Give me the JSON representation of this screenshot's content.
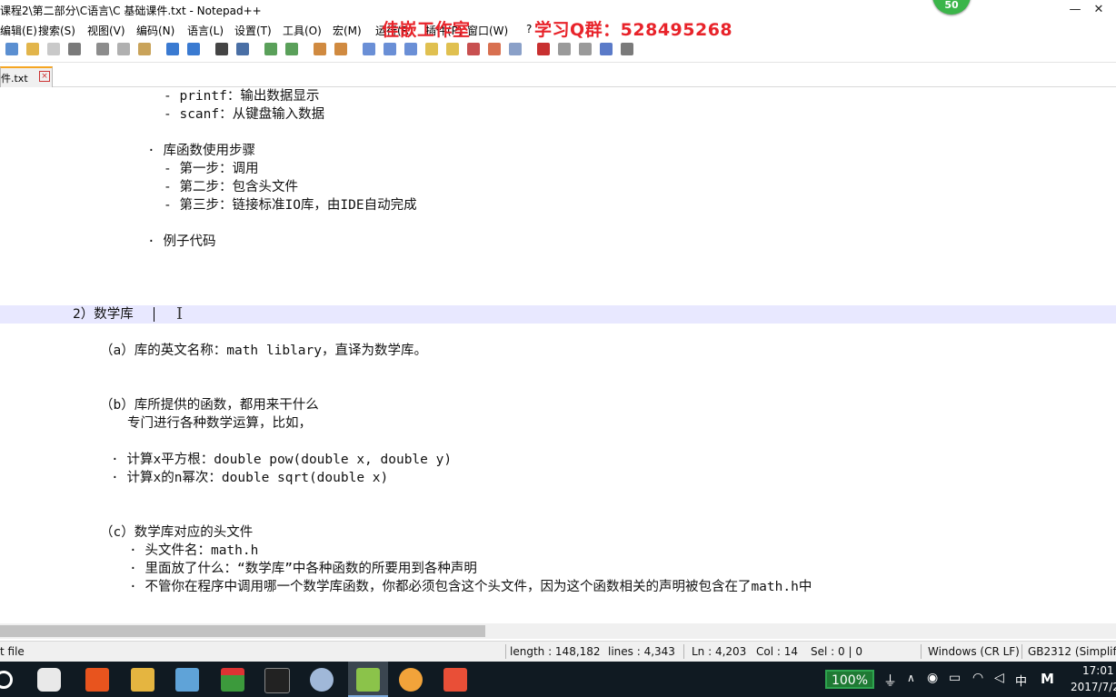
{
  "window": {
    "title": "课程2\\第二部分\\C语言\\C 基础课件.txt - Notepad++",
    "minimize": "—",
    "close": "✕"
  },
  "menu": [
    "编辑(E)",
    "搜索(S)",
    "视图(V)",
    "编码(N)",
    "语言(L)",
    "设置(T)",
    "工具(O)",
    "宏(M)",
    "运行(R)",
    "插件(P)",
    "窗口(W)",
    "?"
  ],
  "overlay": {
    "studio": "佳嵌工作室",
    "qq_group": "学习Q群：528495268",
    "badge": "50"
  },
  "tab": {
    "label": "件.txt"
  },
  "editor": {
    "lines": [
      "- printf：输出数据显示",
      "- scanf：从键盘输入数据",
      "· 库函数使用步骤",
      "- 第一步：调用",
      "- 第二步：包含头文件",
      "- 第三步：链接标准IO库，由IDE自动完成",
      "· 例子代码",
      "2）数学库",
      "（a）库的英文名称：math liblary，直译为数学库。",
      "（b）库所提供的函数，都用来干什么",
      "专门进行各种数学运算，比如，",
      "· 计算x平方根：double pow(double x, double y)",
      "· 计算x的n幂次：double sqrt(double x)",
      "（c）数学库对应的头文件",
      "· 头文件名：math.h",
      "· 里面放了什么：“数学库”中各种函数的所要用到各种声明",
      "· 不管你在程序中调用哪一个数学库函数，你都必须包含这个头文件，因为这个函数相关的声明被包含在了math.h中"
    ]
  },
  "status": {
    "file_type": "t file",
    "length": "length : 148,182",
    "lines": "lines : 4,343",
    "ln": "Ln : 4,203",
    "col": "Col : 14",
    "sel": "Sel : 0 | 0",
    "eol": "Windows (CR LF)",
    "encoding": "GB2312 (Simplifie"
  },
  "taskbar": {
    "battery": "100%",
    "ime": "中",
    "ime2": "M",
    "time": "17:01",
    "date": "2017/7/2"
  }
}
